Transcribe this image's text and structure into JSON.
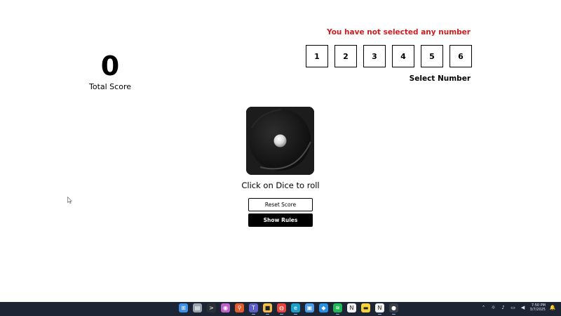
{
  "score": {
    "value": "0",
    "label": "Total Score"
  },
  "selector": {
    "error": "You have not selected any number",
    "numbers": [
      "1",
      "2",
      "3",
      "4",
      "5",
      "6"
    ],
    "label": "Select Number"
  },
  "dice": {
    "face": 1,
    "hint": "Click on Dice to roll"
  },
  "buttons": {
    "reset": "Reset Score",
    "rules": "Show Rules"
  },
  "colors": {
    "error": "#d31b1b",
    "dice": "#1a1a1a",
    "button_dark": "#000000",
    "taskbar": "#1d2433"
  },
  "taskbar": {
    "apps": [
      {
        "name": "windows-start-icon",
        "color": "#3b8de6",
        "glyph": "⊞"
      },
      {
        "name": "file-explorer-icon",
        "color": "#9aa3b0",
        "glyph": "▤"
      },
      {
        "name": "terminal-icon",
        "color": "#2b2f36",
        "glyph": ">"
      },
      {
        "name": "copilot-icon",
        "color": "#c061cb",
        "glyph": "◉"
      },
      {
        "name": "search-app-icon",
        "color": "#e35b2d",
        "glyph": "⚲"
      },
      {
        "name": "teams-icon",
        "color": "#5b5fc7",
        "glyph": "T"
      },
      {
        "name": "folder-icon",
        "color": "#f2c04a",
        "glyph": "■"
      },
      {
        "name": "chrome-icon",
        "color": "#e8453c",
        "glyph": "◍"
      },
      {
        "name": "edge-icon",
        "color": "#1aa0c8",
        "glyph": "e"
      },
      {
        "name": "photos-icon",
        "color": "#4c9be8",
        "glyph": "▣"
      },
      {
        "name": "vscode-icon",
        "color": "#2a8fe0",
        "glyph": "◆"
      },
      {
        "name": "spotify-icon",
        "color": "#1db954",
        "glyph": "≋"
      },
      {
        "name": "notion-icon",
        "color": "#f1f1f1",
        "glyph": "N"
      },
      {
        "name": "sticky-notes-icon",
        "color": "#f6d33c",
        "glyph": "▬"
      },
      {
        "name": "notion-calendar-icon",
        "color": "#f1f1f1",
        "glyph": "N"
      },
      {
        "name": "github-icon",
        "color": "#3a3f47",
        "glyph": "●"
      }
    ],
    "clock": {
      "time": "7:50 PM",
      "date": "3/7/2025"
    }
  }
}
